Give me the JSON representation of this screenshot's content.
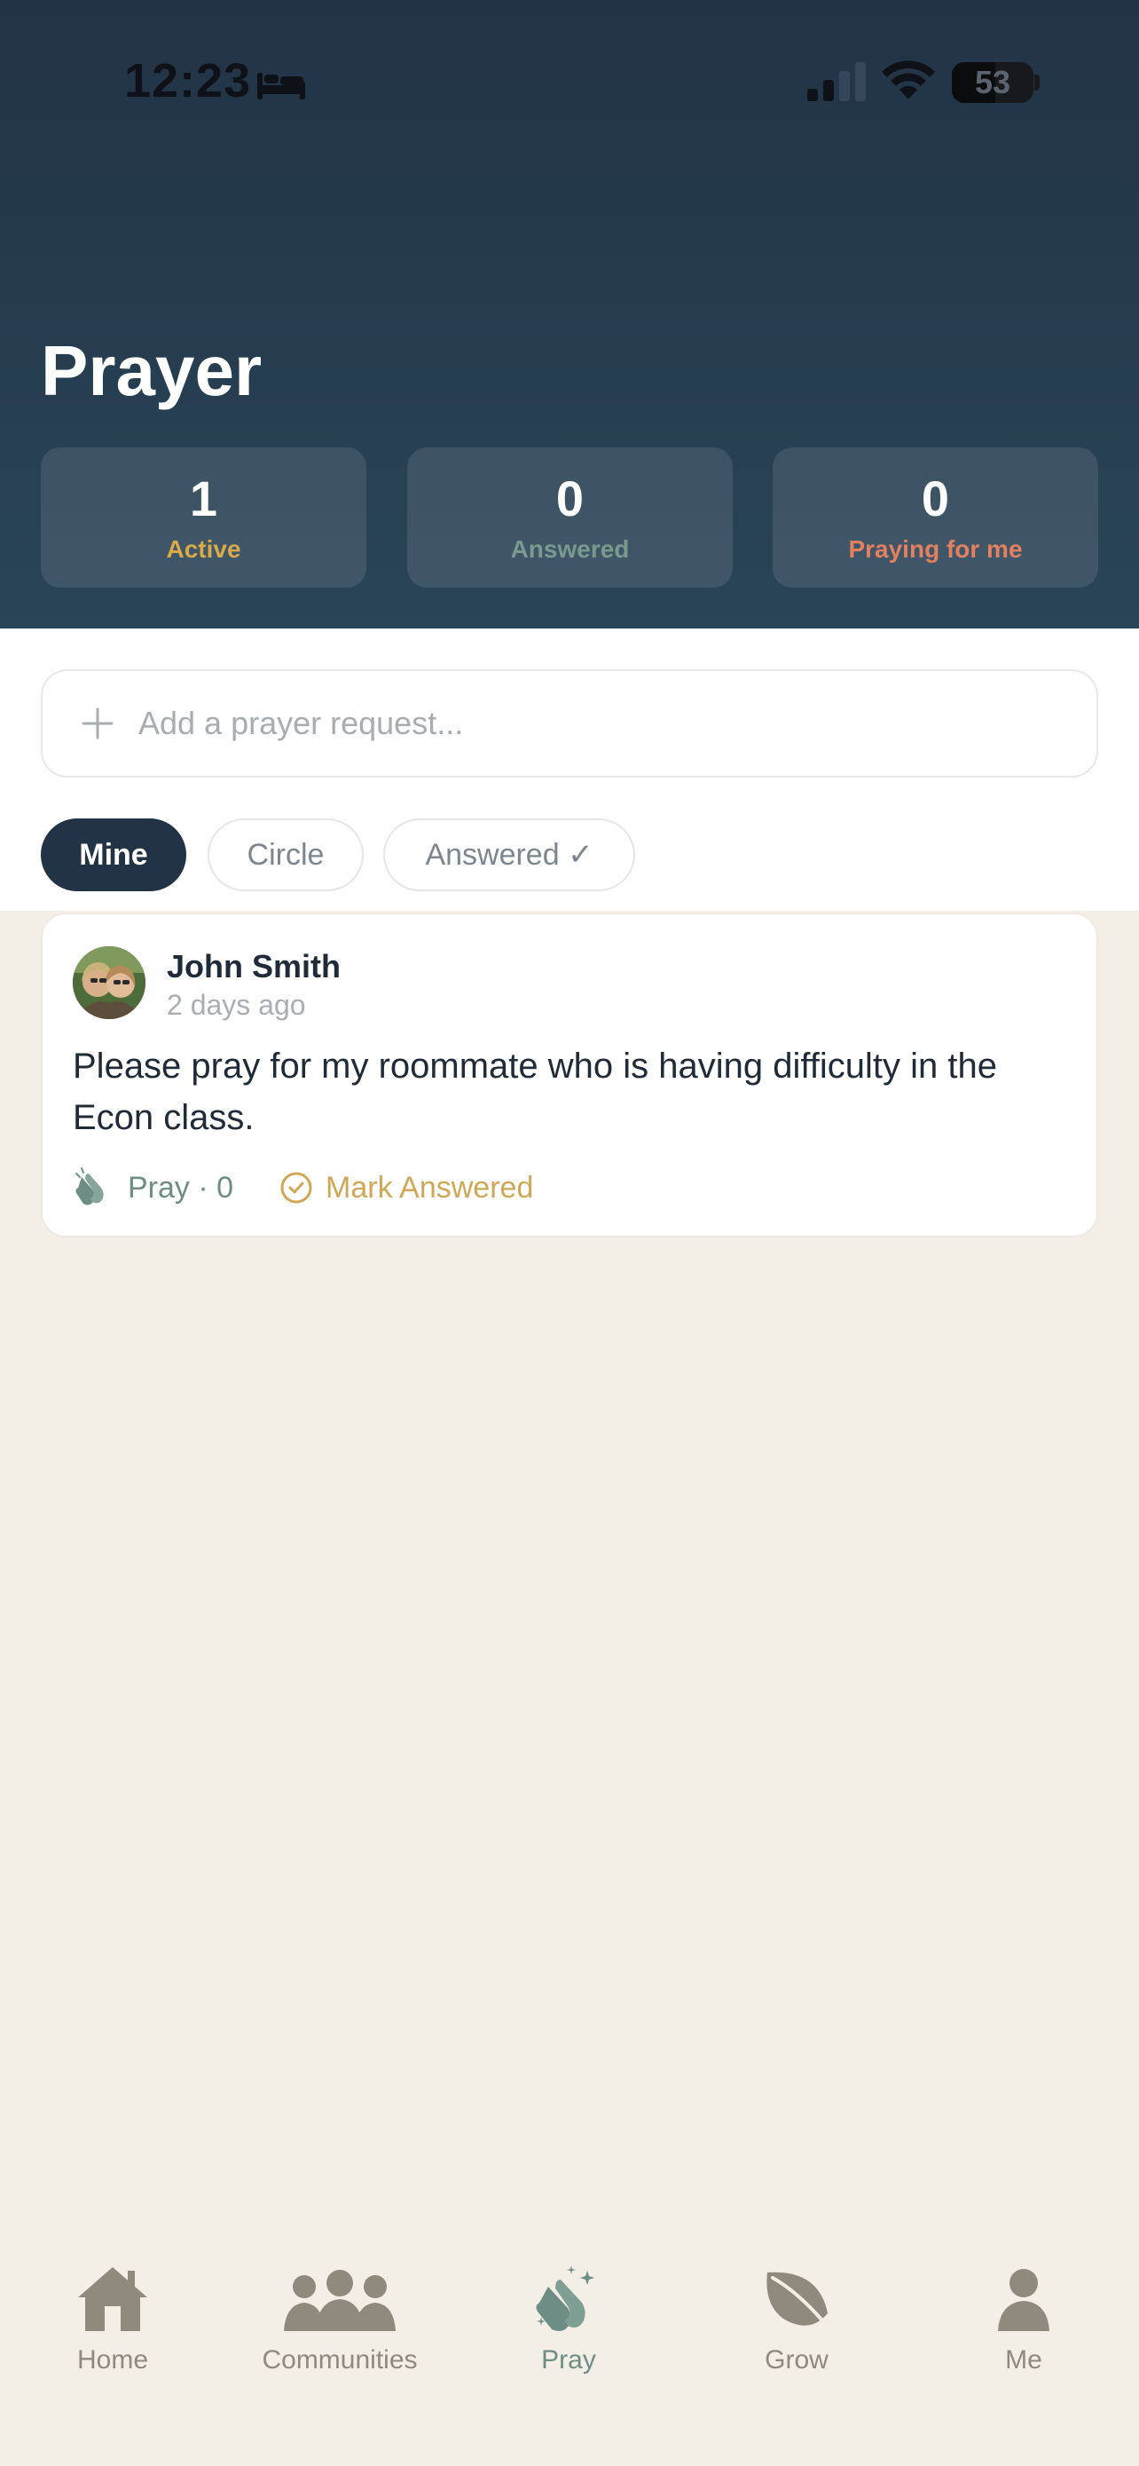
{
  "status_bar": {
    "time": "12:23",
    "battery": "53",
    "battery_level": 0.53,
    "icons": [
      "bed-icon",
      "signal-icon",
      "wifi-icon",
      "battery-icon"
    ]
  },
  "header": {
    "title": "Prayer",
    "stats": [
      {
        "value": "1",
        "label": "Active",
        "color": "#D9A94A"
      },
      {
        "value": "0",
        "label": "Answered",
        "color": "#7A9A8E"
      },
      {
        "value": "0",
        "label": "Praying for me",
        "color": "#E2805F"
      }
    ]
  },
  "composer": {
    "placeholder": "Add a prayer request...",
    "icon": "plus-icon"
  },
  "filters": {
    "tabs": [
      {
        "label": "Mine",
        "active": true
      },
      {
        "label": "Circle",
        "active": false
      },
      {
        "label": "Answered ✓",
        "active": false
      }
    ]
  },
  "posts": [
    {
      "author": "John Smith",
      "time": "2 days ago",
      "text": "Please pray for my roommate who is having difficulty in the Econ class.",
      "pray_label": "Pray · 0",
      "mark_answered_label": "Mark Answered"
    }
  ],
  "nav": {
    "items": [
      {
        "label": "Home",
        "icon": "home-icon",
        "active": false
      },
      {
        "label": "Communities",
        "icon": "communities-icon",
        "active": false
      },
      {
        "label": "Pray",
        "icon": "praying-hands-icon",
        "active": true
      },
      {
        "label": "Grow",
        "icon": "leaf-icon",
        "active": false
      },
      {
        "label": "Me",
        "icon": "person-icon",
        "active": false
      }
    ]
  },
  "colors": {
    "header_bg": "#223345",
    "page_bg": "#F3EEE6",
    "accent_green": "#6E8E85",
    "accent_gold": "#D0A755",
    "nav_inactive": "#8F8A7D"
  }
}
